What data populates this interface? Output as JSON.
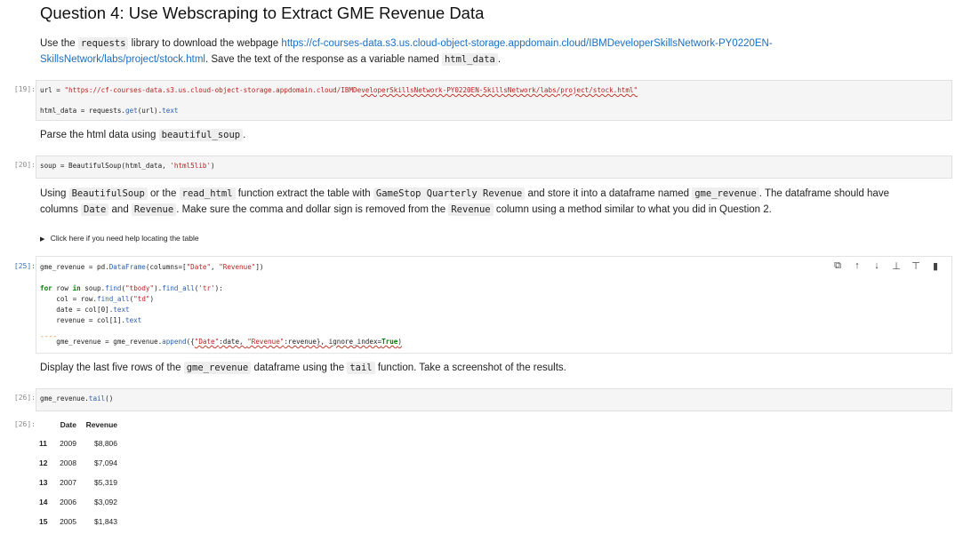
{
  "heading": "Question 4: Use Webscraping to Extract GME Revenue Data",
  "intro": {
    "t1": "Use the",
    "code1": "requests",
    "t2": "library to download the webpage",
    "url_line1": "https://cf-courses-data.s3.us.cloud-object-storage.appdomain.cloud/IBMDeveloperSkillsNetwork-PY0220EN-",
    "url_line2": "SkillsNetwork/labs/project/stock.html",
    "t3": ". Save the text of the response as a variable named",
    "code2": "html_data",
    "t4": "."
  },
  "cell19": {
    "prompt": "[19]:",
    "line1_a": "url = ",
    "line1_str_a": "\"https://cf-courses-data.s3.us.cloud-object-storage.appdomain.cloud/IBMDe",
    "line1_str_b": "veloperSkillsNetwork-PY0220EN-SkillsNetwork/labs/project/stock.html\"",
    "line2_a": "html_data = requests.",
    "line2_fn": "get",
    "line2_b": "(url).",
    "line2_attr": "text"
  },
  "parse_text": {
    "t1": "Parse the html data using",
    "code": "beautiful_soup",
    "t2": "."
  },
  "cell20": {
    "prompt": "[20]:",
    "a": "soup = BeautifulSoup(html_data, ",
    "str": "'html5lib'",
    "b": ")"
  },
  "instr": {
    "t1": "Using",
    "c1": "BeautifulSoup",
    "t2": "or the",
    "c2": "read_html",
    "t3": "function extract the table with",
    "c3": "GameStop Quarterly Revenue",
    "t4": "and store it into a dataframe named",
    "c4": "gme_revenue",
    "t5": ". The dataframe should have",
    "t6": "columns",
    "c5": "Date",
    "t7": "and",
    "c6": "Revenue",
    "t8": ". Make sure the comma and dollar sign is removed from the",
    "c7": "Revenue",
    "t9": "column using a method similar to what you did in Question 2."
  },
  "details": {
    "arrow": "▶",
    "label": "Click here if you need help locating the table"
  },
  "cell25": {
    "prompt": "[25]:",
    "l1_a": "gme_revenue = pd.",
    "l1_fn": "DataFrame",
    "l1_b": "(columns=[",
    "l1_s1": "\"Date\"",
    "l1_c": ", ",
    "l1_s2": "\"Revenue\"",
    "l1_d": "])",
    "l3_kw1": "for",
    "l3_a": " row ",
    "l3_kw2": "in",
    "l3_b": " soup.",
    "l3_fn1": "find",
    "l3_c": "(",
    "l3_s1": "\"tbody\"",
    "l3_d": ").",
    "l3_fn2": "find_all",
    "l3_e": "(",
    "l3_s2": "'tr'",
    "l3_f": "):",
    "l4_a": "    col = row.",
    "l4_fn": "find_all",
    "l4_b": "(",
    "l4_s": "\"td\"",
    "l4_c": ")",
    "l5_a": "    date = col[0].",
    "l5_attr": "text",
    "l6_a": "    revenue = col[1].",
    "l6_attr": "text",
    "dashes": "----",
    "l8_a": "    gme_revenue = gme_revenue.",
    "l8_fn": "append",
    "l8_b": "({",
    "l8_s1": "\"Date\"",
    "l8_c": ":date, ",
    "l8_s2": "\"Revenue\"",
    "l8_d": ":revenue}, ignore_index=",
    "l8_kw": "True",
    "l8_e": ")"
  },
  "toolbar": {
    "copy": "⧉",
    "up": "↑",
    "down": "↓",
    "insert_above": "⊥",
    "insert_below": "⊤",
    "delete": "▮"
  },
  "display_text": {
    "t1": "Display the last five rows of the",
    "c1": "gme_revenue",
    "t2": "dataframe using the",
    "c2": "tail",
    "t3": "function. Take a screenshot of the results."
  },
  "cell26": {
    "prompt": "[26]:",
    "a": "gme_revenue.",
    "fn": "tail",
    "b": "()"
  },
  "output26": {
    "prompt": "[26]:",
    "columns": [
      "Date",
      "Revenue"
    ],
    "rows": [
      {
        "idx": "11",
        "date": "2009",
        "revenue": "$8,806"
      },
      {
        "idx": "12",
        "date": "2008",
        "revenue": "$7,094"
      },
      {
        "idx": "13",
        "date": "2007",
        "revenue": "$5,319"
      },
      {
        "idx": "14",
        "date": "2006",
        "revenue": "$3,092"
      },
      {
        "idx": "15",
        "date": "2005",
        "revenue": "$1,843"
      }
    ]
  }
}
